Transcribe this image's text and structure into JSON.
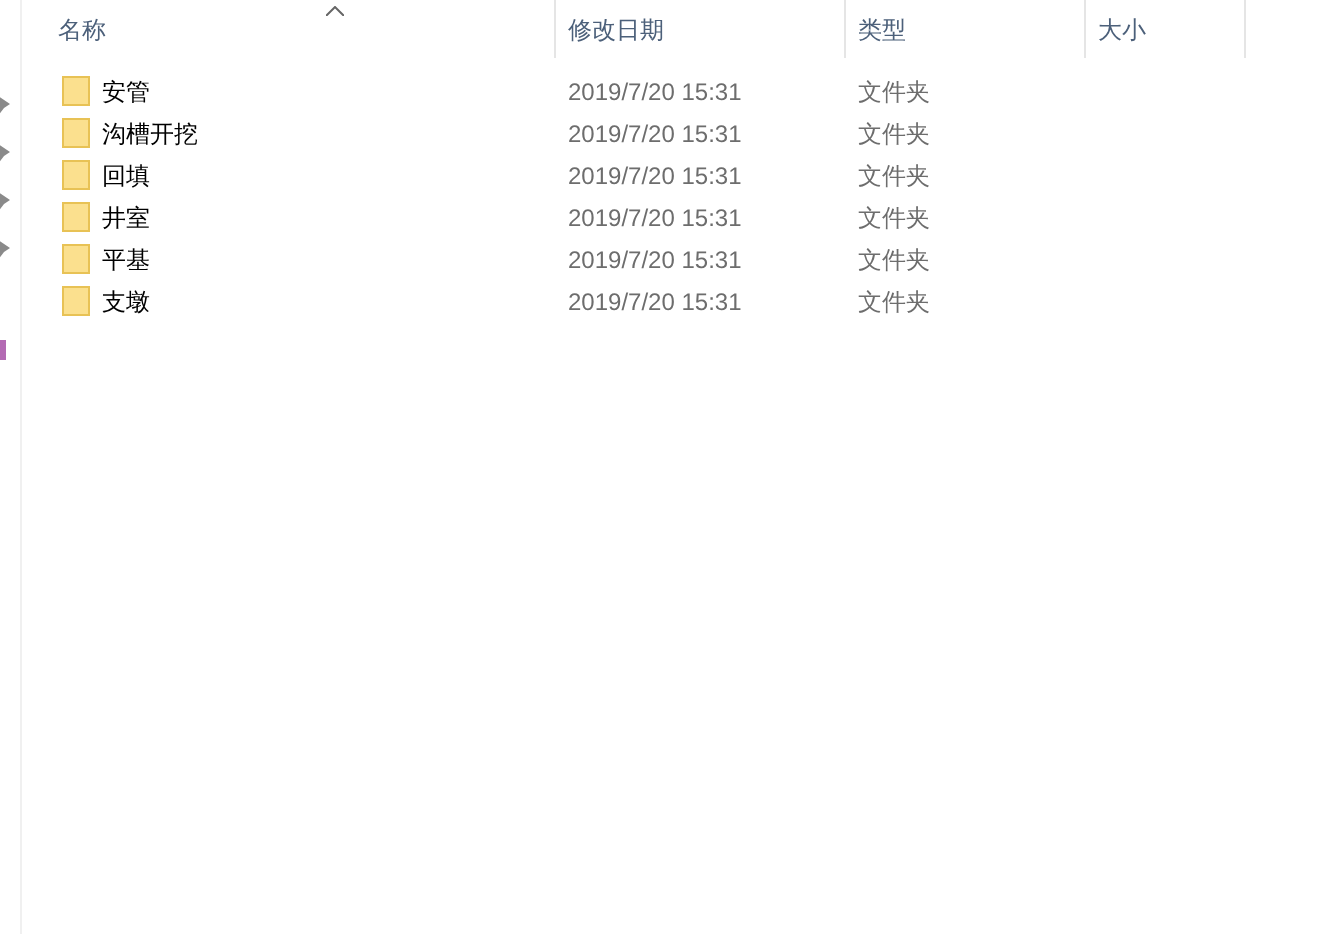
{
  "columns": [
    "名称",
    "修改日期",
    "类型",
    "大小"
  ],
  "rows": [
    {
      "name": "安管",
      "modified": "2019/7/20 15:31",
      "type": "文件夹"
    },
    {
      "name": "沟槽开挖",
      "modified": "2019/7/20 15:31",
      "type": "文件夹"
    },
    {
      "name": "回填",
      "modified": "2019/7/20 15:31",
      "type": "文件夹"
    },
    {
      "name": "井室",
      "modified": "2019/7/20 15:31",
      "type": "文件夹"
    },
    {
      "name": "平基",
      "modified": "2019/7/20 15:31",
      "type": "文件夹"
    },
    {
      "name": "支墩",
      "modified": "2019/7/20 15:31",
      "type": "文件夹"
    }
  ]
}
